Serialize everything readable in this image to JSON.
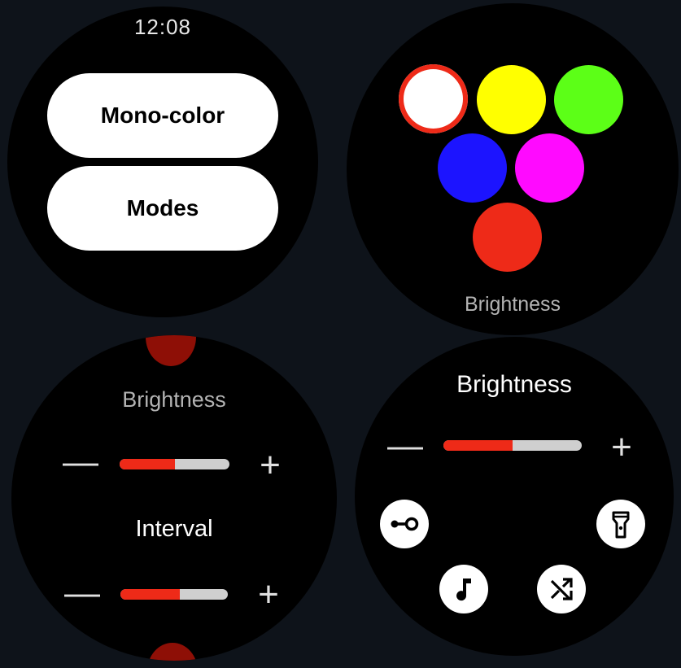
{
  "panel1": {
    "time": "12:08",
    "buttons": [
      "Mono-color",
      "Modes"
    ]
  },
  "panel2": {
    "colors": [
      {
        "name": "white",
        "hex": "#ffffff",
        "selected": true
      },
      {
        "name": "yellow",
        "hex": "#ffff00",
        "selected": false
      },
      {
        "name": "green",
        "hex": "#5cff17",
        "selected": false
      },
      {
        "name": "blue",
        "hex": "#1c14ff",
        "selected": false
      },
      {
        "name": "magenta",
        "hex": "#ff0aff",
        "selected": false
      },
      {
        "name": "red",
        "hex": "#ee2a18",
        "selected": false
      }
    ],
    "footer_label": "Brightness"
  },
  "panel3": {
    "brightness": {
      "label": "Brightness",
      "minus": "—",
      "plus": "+",
      "level": 0.5
    },
    "interval": {
      "label": "Interval",
      "minus": "—",
      "plus": "+",
      "level": 0.55
    }
  },
  "panel4": {
    "brightness": {
      "label": "Brightness",
      "minus": "—",
      "plus": "+",
      "level": 0.5
    },
    "icons": [
      "key-icon",
      "flashlight-icon",
      "music-note-icon",
      "shuffle-icon"
    ]
  },
  "colors": {
    "accent": "#ee2a18",
    "track": "#cfcfcf",
    "background": "#0e131a",
    "watch": "#000000"
  }
}
